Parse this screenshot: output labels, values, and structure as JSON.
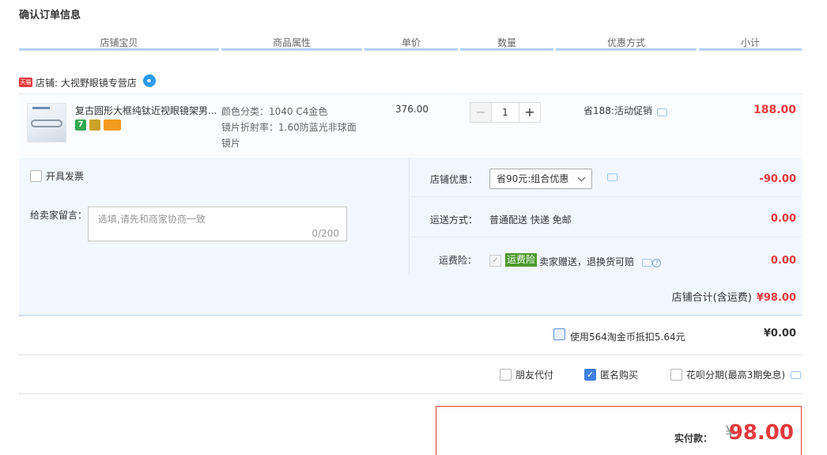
{
  "page_title": "确认订单信息",
  "table_headers": [
    "店铺宝贝",
    "商品属性",
    "单价",
    "数量",
    "优惠方式",
    "小计"
  ],
  "shop": {
    "badge": "天猫",
    "name": "店铺: 大视野眼镜专营店"
  },
  "item": {
    "title": "复古圆形大框纯钛近视眼镜架男...",
    "attr_color": "颜色分类：1040 C4金色",
    "attr_lens": "镜片折射率：1.60防蓝光非球面镜片",
    "price": "376.00",
    "quantity": "1",
    "qty_minus": "−",
    "qty_plus": "+",
    "promo": "省188:活动促销",
    "subtotal": "188.00",
    "badge_seven": "7"
  },
  "invoice_label": "开具发票",
  "message": {
    "label": "给卖家留言：",
    "placeholder": "选填,请先和商家协商一致",
    "count": "0/200"
  },
  "discount": {
    "label": "店铺优惠：",
    "selected": "省90元:组合优惠",
    "value": "-90.00"
  },
  "shipping": {
    "label": "运送方式：",
    "method": "普通配送 快递 免邮",
    "value": "0.00"
  },
  "insurance": {
    "label": "运费险：",
    "badge": "运费险",
    "text": "卖家赠送，退换货可赔",
    "value": "0.00",
    "help": "?"
  },
  "shop_total": {
    "label": "店铺合计(含运费)",
    "value": "¥98.00"
  },
  "coins": {
    "label": "使用564淘金币抵扣5.64元",
    "value": "¥0.00"
  },
  "options": {
    "friend_pay": "朋友代付",
    "anonymous": "匿名购买",
    "huabei": "花呗分期(最高3期免息)"
  },
  "payment": {
    "label": "实付款：",
    "currency": "¥",
    "amount": "98.00"
  },
  "colors": {
    "accent_red": "#e4393c",
    "header_border": "#b2d1ff",
    "panel_bg": "#f2f7ff",
    "check_blue": "#3f7fe4",
    "insurance_green": "#4c9a2a"
  }
}
